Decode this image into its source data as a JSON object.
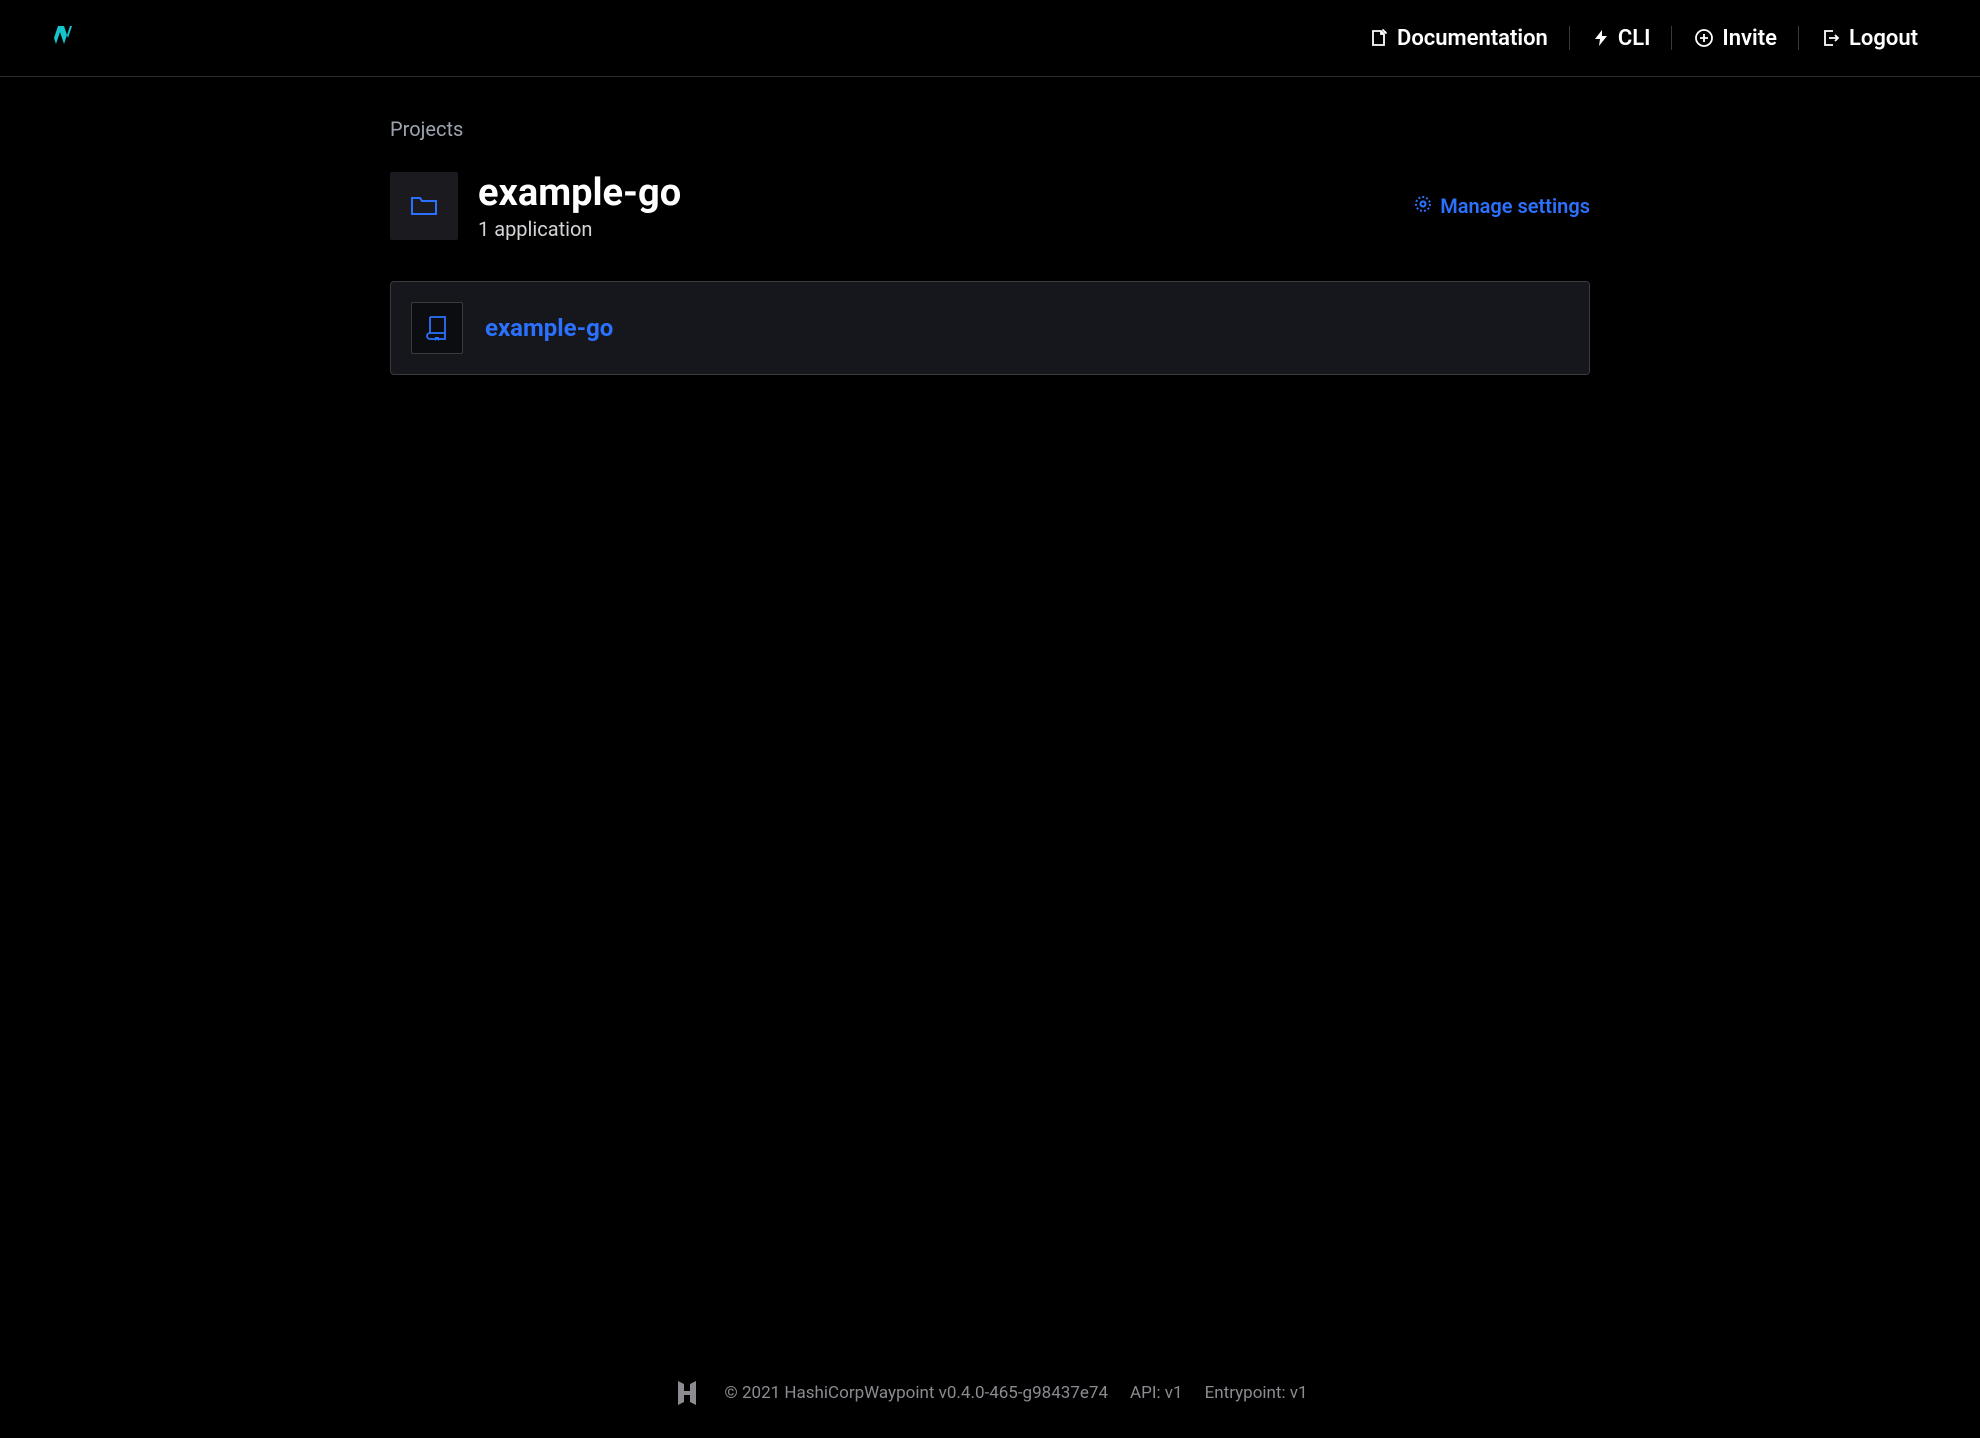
{
  "nav": {
    "documentation": "Documentation",
    "cli": "CLI",
    "invite": "Invite",
    "logout": "Logout"
  },
  "breadcrumb": "Projects",
  "project": {
    "name": "example-go",
    "subtitle": "1 application",
    "manage_settings": "Manage settings"
  },
  "applications": [
    {
      "name": "example-go"
    }
  ],
  "footer": {
    "copyright": "© 2021 HashiCorpWaypoint v0.4.0-465-g98437e74",
    "api": "API: v1",
    "entrypoint": "Entrypoint: v1"
  }
}
